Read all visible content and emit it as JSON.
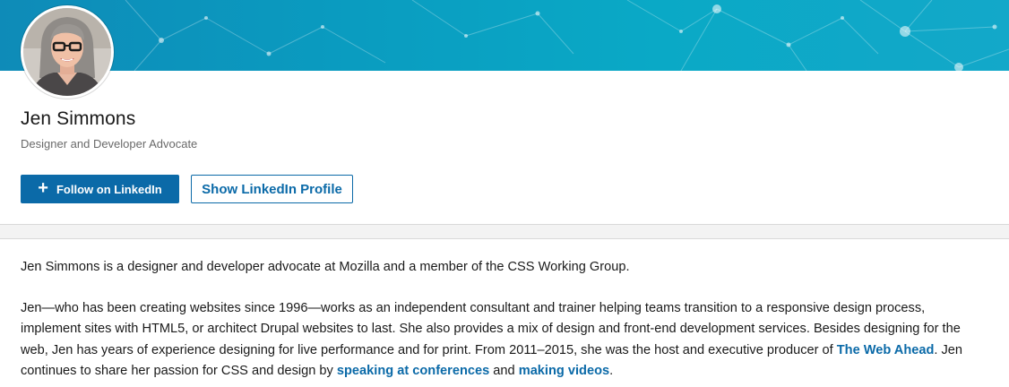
{
  "profile": {
    "name": "Jen Simmons",
    "headline": "Designer and Developer Advocate"
  },
  "actions": {
    "follow_label": "Follow on LinkedIn",
    "follow_icon": "plus-icon",
    "profile_label": "Show LinkedIn Profile"
  },
  "about": {
    "p1": "Jen Simmons is a designer and developer advocate at Mozilla and a member of the CSS Working Group.",
    "p2_part1": "Jen—who has been creating websites since 1996—works as an independent consultant and trainer helping teams transition to a responsive design process, implement sites with HTML5, or architect Drupal websites to last. She also provides a mix of design and front-end development services. Besides designing for the web, Jen has years of experience designing for live performance and for print. From 2011–2015, she was the host and executive producer of ",
    "link_web_ahead": "The Web Ahead",
    "p2_part2": ". Jen continues to share her passion for CSS and design by ",
    "link_conferences": "speaking at conferences",
    "p2_part3": " and ",
    "link_videos": "making videos",
    "p2_part4": "."
  },
  "colors": {
    "brand_blue": "#0b6aa8",
    "banner_start": "#0e8bb8",
    "banner_end": "#13a8c9"
  }
}
